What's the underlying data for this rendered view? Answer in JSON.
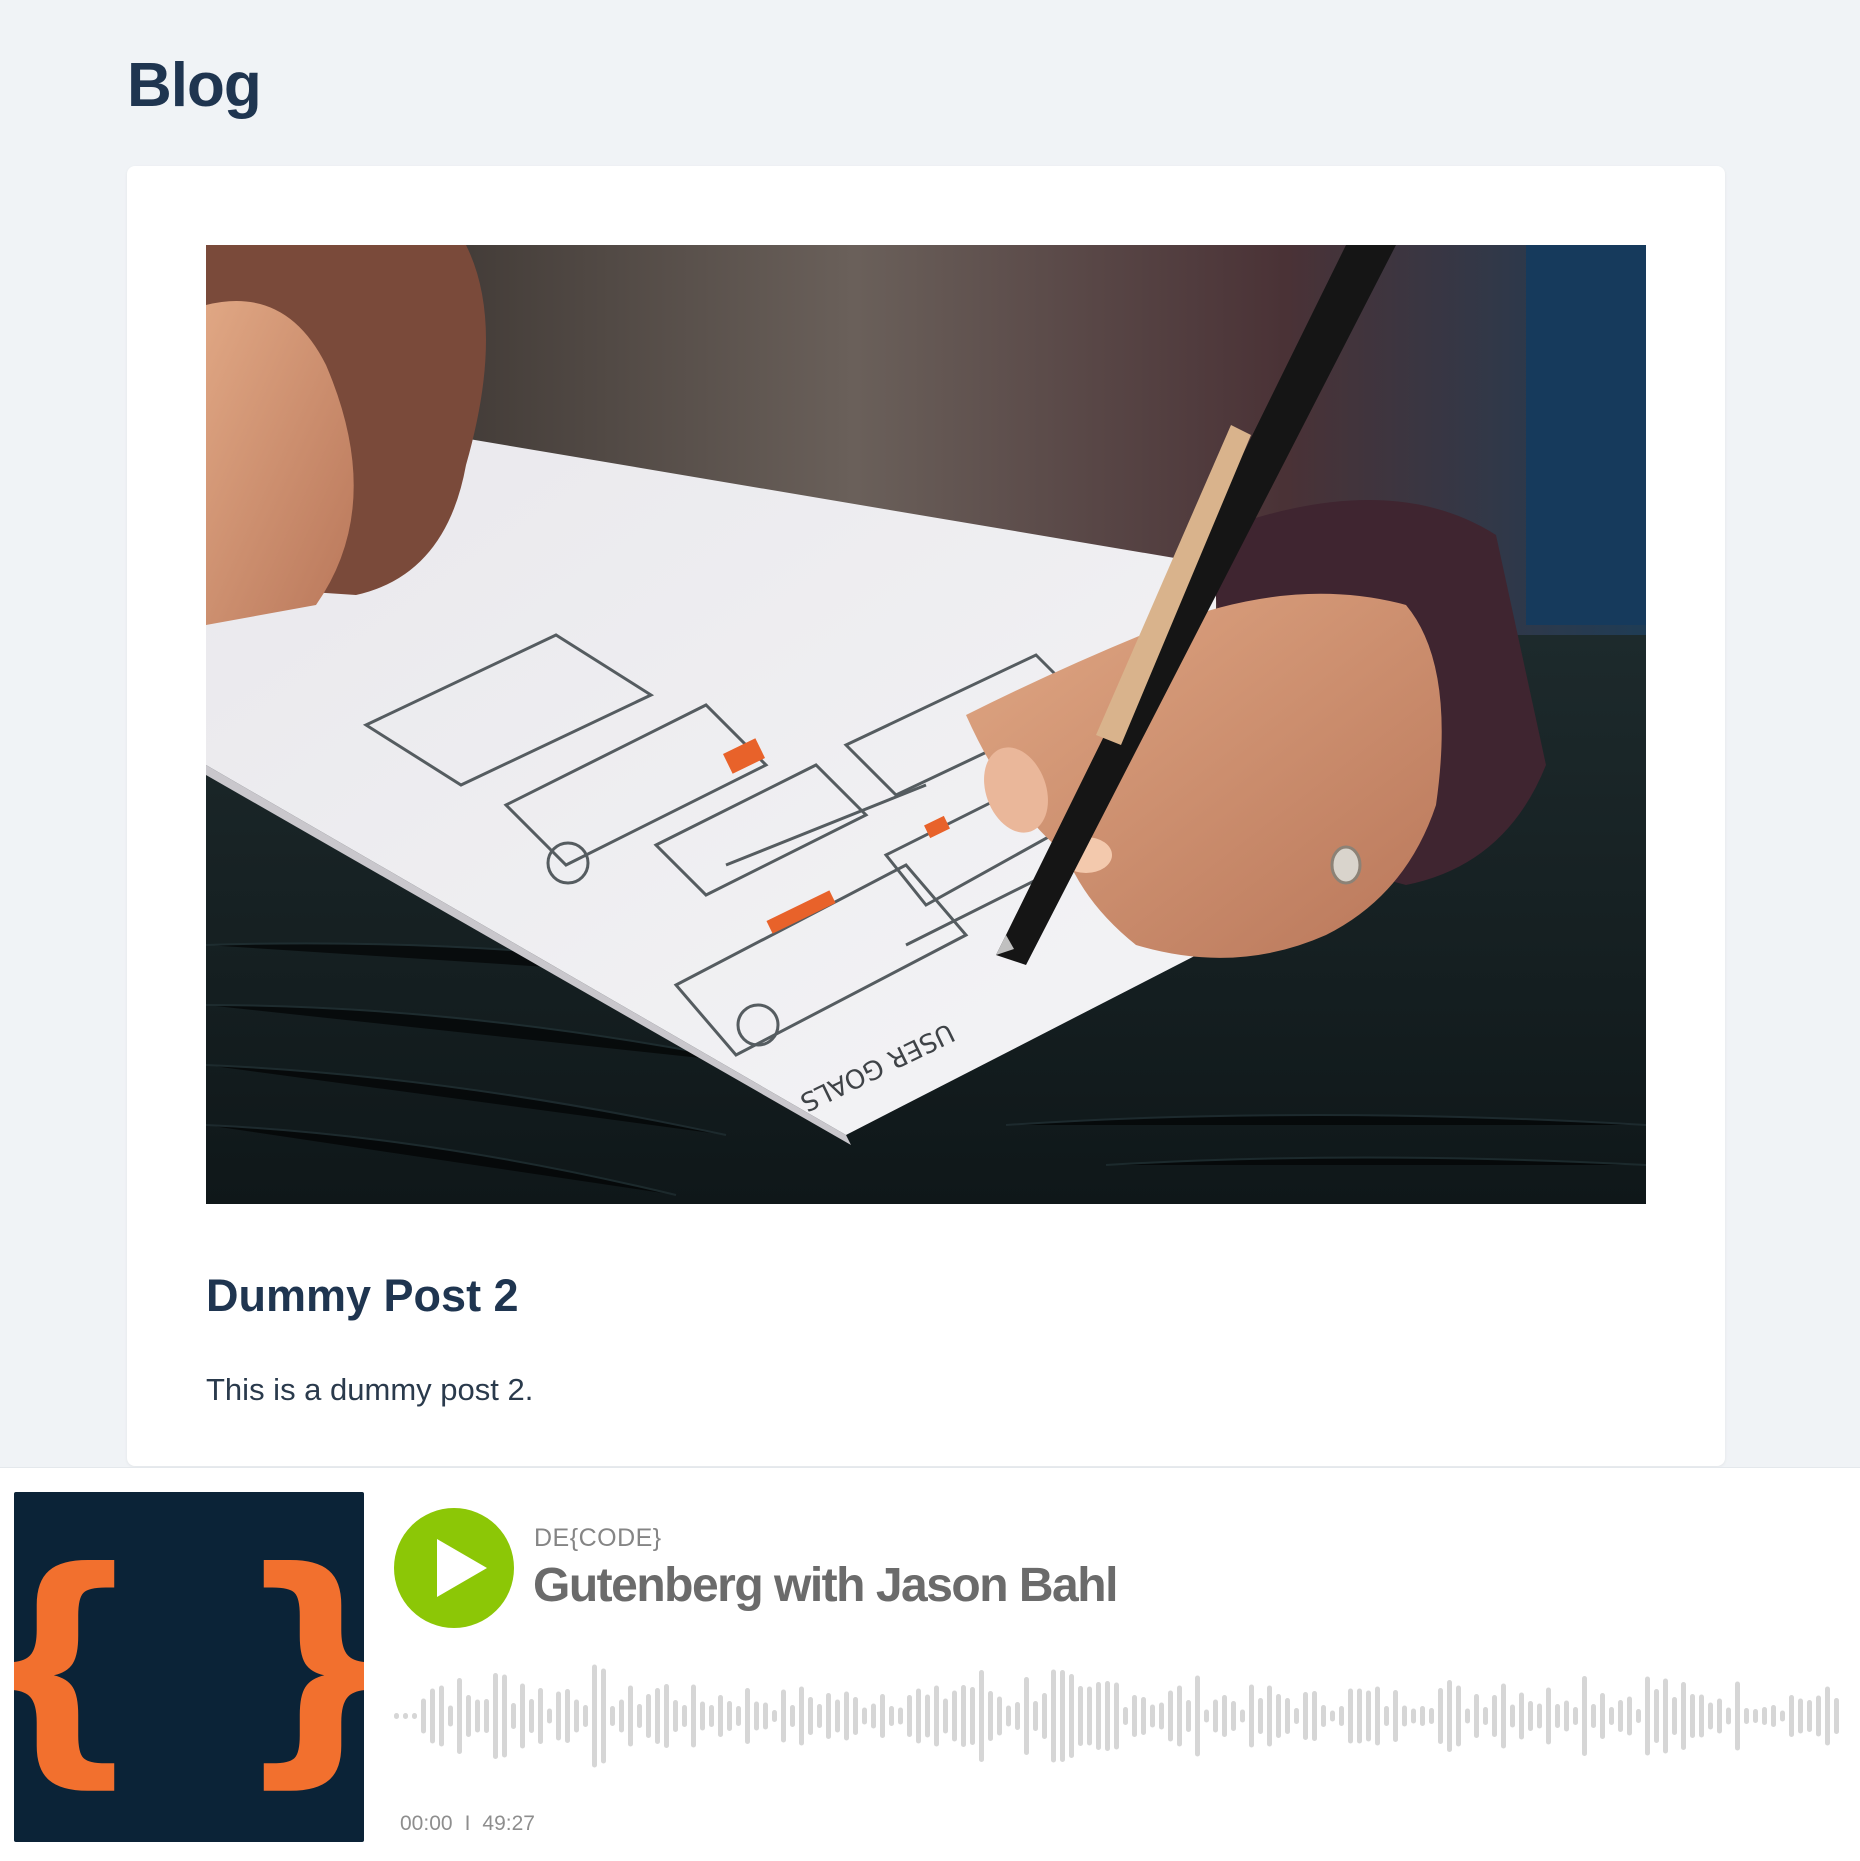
{
  "page": {
    "title": "Blog"
  },
  "post": {
    "title": "Dummy Post 2",
    "excerpt": "This is a dummy post 2.",
    "image": {
      "desc": "Hand sketching UI wireframes with a pen on paper",
      "sketch_text": "USER GOALS"
    }
  },
  "player": {
    "artwork_glyph": "{ }",
    "show_name": "DE{CODE}",
    "episode_title": "Gutenberg with Jason Bahl",
    "current_time": "00:00",
    "separator": "I",
    "duration": "49:27",
    "progress": 0,
    "icons": {
      "play": "play-icon",
      "artwork": "curly-braces-icon",
      "waveform": "waveform-icon"
    }
  },
  "colors": {
    "background": "#f0f3f6",
    "heading": "#1f3550",
    "play_button": "#8cc706",
    "artwork_bg": "#0b2337",
    "artwork_braces": "#f2702e",
    "waveform": "#d6d6d6"
  }
}
